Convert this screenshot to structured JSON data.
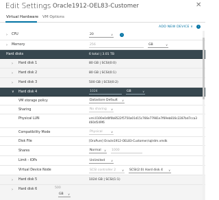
{
  "header": {
    "title": "Edit Settings",
    "vm_name": "Oracle1912-OEL83-Customer"
  },
  "tabs": [
    {
      "label": "Virtual Hardware"
    },
    {
      "label": "VM Options"
    }
  ],
  "add_new_device": "ADD NEW DEVICE",
  "cpu": {
    "label": "CPU",
    "value": "20"
  },
  "memory": {
    "label": "Memory",
    "value": "256",
    "unit": "GB"
  },
  "hard_disks_summary": {
    "label": "Hard disks",
    "value": "6 total | 3.01 TB"
  },
  "disks": [
    {
      "label": "Hard disk 1",
      "value": "80 GB | SCSI(0:0)"
    },
    {
      "label": "Hard disk 2",
      "value": "80 GB | SCSI(0:1)"
    },
    {
      "label": "Hard disk 3",
      "value": "500 GB | SCSI(0:2)"
    }
  ],
  "disk4": {
    "label": "Hard disk 4",
    "size": "1024",
    "unit": "GB",
    "storage_policy_label": "VM storage policy",
    "storage_policy_value": "Datastore Default",
    "sharing_label": "Sharing",
    "sharing_value": "No sharing",
    "lun_label": "Physical LUN",
    "lun_value": "vml.0100e0d0f0b8522f5750a01d15c766e77981e7f69eb816c2287bd7cca3460d549f6",
    "compat_label": "Compatibility Mode",
    "compat_value": "Physical",
    "file_label": "Disk File",
    "file_value": "[OraPure] Oracle1912-OEL83-Customer/sqlrdm.vmdk",
    "shares_label": "Shares",
    "shares_value": "Normal",
    "shares_num": "1000",
    "limit_label": "Limit - IOPs",
    "limit_value": "Unlimited",
    "node_label": "Virtual Device Node",
    "node_ctrl": "SCSI controller 2",
    "node_slot": "SCSI(2:0) Hard disk 4"
  },
  "disk5": {
    "label": "Hard disk 5",
    "value": "1024 GB | SCSI(1:1)"
  },
  "disk6": {
    "label": "Hard disk 6",
    "size": "500",
    "unit": "GB"
  }
}
